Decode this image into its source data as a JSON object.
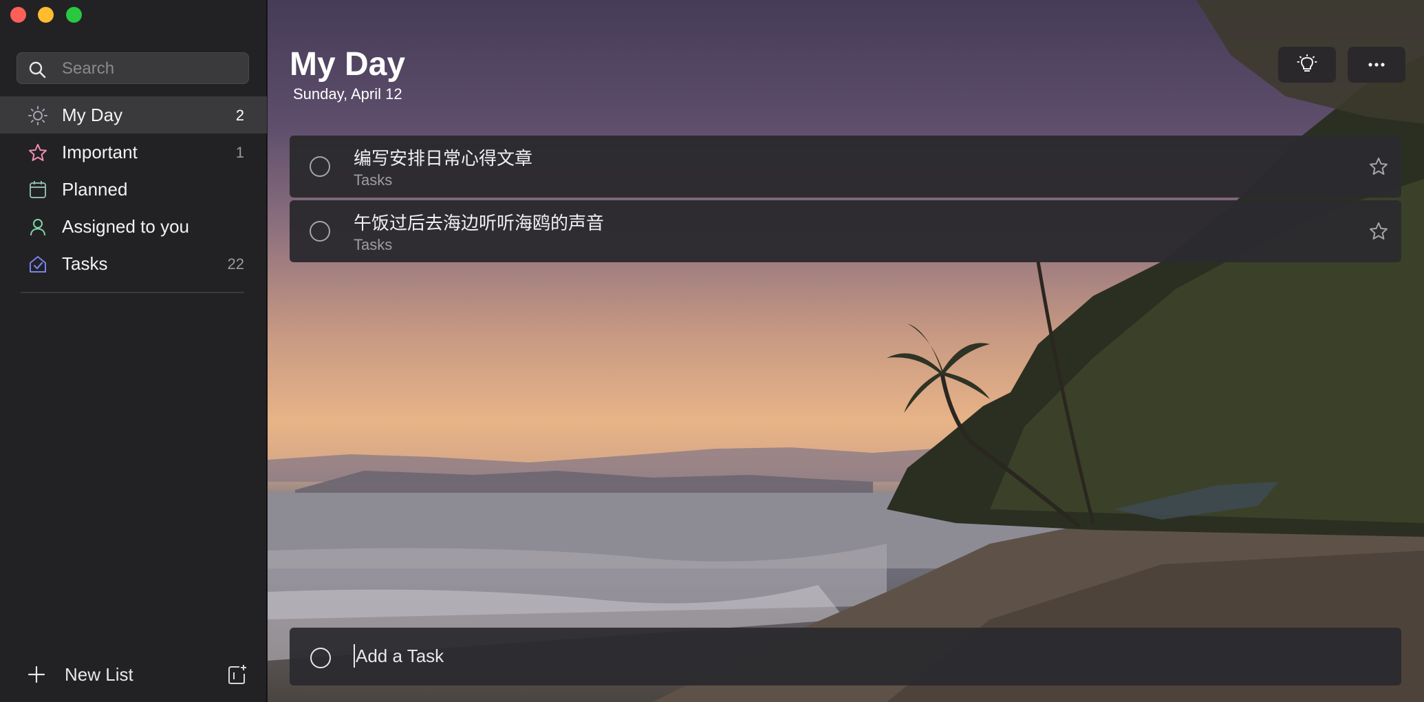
{
  "window": {
    "controls": [
      "close",
      "minimize",
      "maximize"
    ]
  },
  "sidebar": {
    "search": {
      "placeholder": "Search",
      "icon": "search-icon"
    },
    "items": [
      {
        "label": "My Day",
        "count": "2",
        "icon": "sun-icon",
        "color": "#9a9aa8",
        "active": true
      },
      {
        "label": "Important",
        "count": "1",
        "icon": "star-icon",
        "color": "#f48fb1",
        "active": false
      },
      {
        "label": "Planned",
        "count": "",
        "icon": "calendar-icon",
        "color": "#8fb8a8",
        "active": false
      },
      {
        "label": "Assigned to you",
        "count": "",
        "icon": "person-icon",
        "color": "#7fd6a4",
        "active": false
      },
      {
        "label": "Tasks",
        "count": "22",
        "icon": "home-check-icon",
        "color": "#7b83eb",
        "active": false
      }
    ],
    "new_list": {
      "label": "New List",
      "icon": "plus-icon",
      "group_icon": "new-group-icon"
    }
  },
  "main": {
    "title": "My Day",
    "date": "Sunday, April 12",
    "header_buttons": [
      "suggestions-lightbulb-icon",
      "more-options-icon"
    ],
    "tasks": [
      {
        "title": "编写安排日常心得文章",
        "list": "Tasks",
        "starred": false
      },
      {
        "title": "午饭过后去海边听听海鸥的声音",
        "list": "Tasks",
        "starred": false
      }
    ],
    "add_task": {
      "placeholder": "Add a Task"
    }
  }
}
